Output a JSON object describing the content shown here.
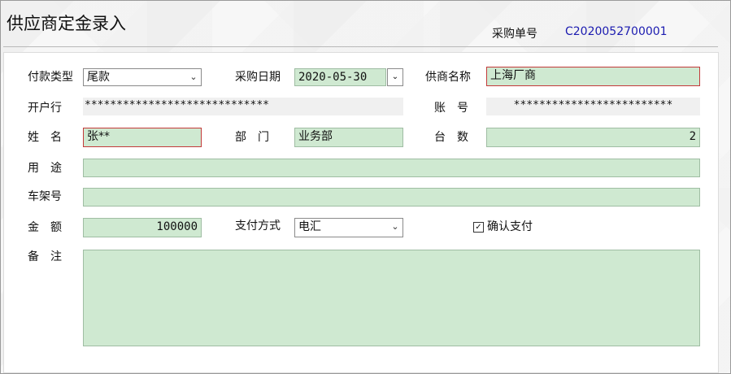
{
  "window": {
    "title": "供应商定金录入"
  },
  "header": {
    "order_label": "采购单号",
    "order_value": "C2020052700001"
  },
  "form": {
    "payment_type": {
      "label": "付款类型",
      "value": "尾款"
    },
    "purchase_date": {
      "label": "采购日期",
      "value": "2020-05-30"
    },
    "supplier_name": {
      "label": "供商名称",
      "value": "上海厂商"
    },
    "bank": {
      "label": "开户行",
      "value": "*****************************"
    },
    "account": {
      "label": "账　号",
      "value": "*************************"
    },
    "name": {
      "label": "姓　名",
      "value": "张**"
    },
    "department": {
      "label": "部　门",
      "value": "业务部"
    },
    "quantity": {
      "label": "台　数",
      "value": "2"
    },
    "purpose": {
      "label": "用　途",
      "value": ""
    },
    "frame_no": {
      "label": "车架号",
      "value": ""
    },
    "amount": {
      "label": "金　额",
      "value": "100000"
    },
    "payment_method": {
      "label": "支付方式",
      "value": "电汇"
    },
    "confirm_payment": {
      "label": "确认支付",
      "checked": true
    },
    "remarks": {
      "label": "备　注",
      "value": ""
    }
  },
  "icons": {
    "dropdown": "chevron-down-icon",
    "checkbox": "checkmark-icon"
  }
}
